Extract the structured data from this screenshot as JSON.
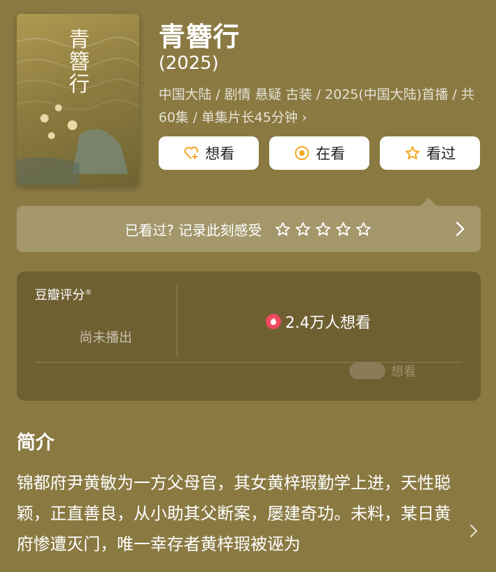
{
  "poster": {
    "title_chars": [
      "青",
      "簪",
      "行"
    ]
  },
  "movie": {
    "title": "青簪行",
    "year": "(2025)",
    "meta_line": "中国大陆 / 剧情 悬疑 古装 / 2025(中国大陆)首播 / 共60集 / 单集片长45分钟"
  },
  "actions": {
    "want_label": "想看",
    "watching_label": "在看",
    "watched_label": "看过"
  },
  "record": {
    "prompt": "已看过? 记录此刻感受",
    "star_count": 5
  },
  "rating": {
    "label": "豆瓣评分",
    "label_mark": "®",
    "status": "尚未播出",
    "want_count": "2.4万人想看",
    "faint_label": "想看"
  },
  "intro": {
    "title": "简介",
    "text": "锦都府尹黄敏为一方父母官，其女黄梓瑕勤学上进，天性聪颖，正直善良，从小助其父断案，屡建奇功。未料，某日黄府惨遭灭门，唯一幸存者黄梓瑕被诬为"
  },
  "colors": {
    "background": "#8a7a42",
    "accent": "#f5a623",
    "fire": "#f04a5f"
  }
}
